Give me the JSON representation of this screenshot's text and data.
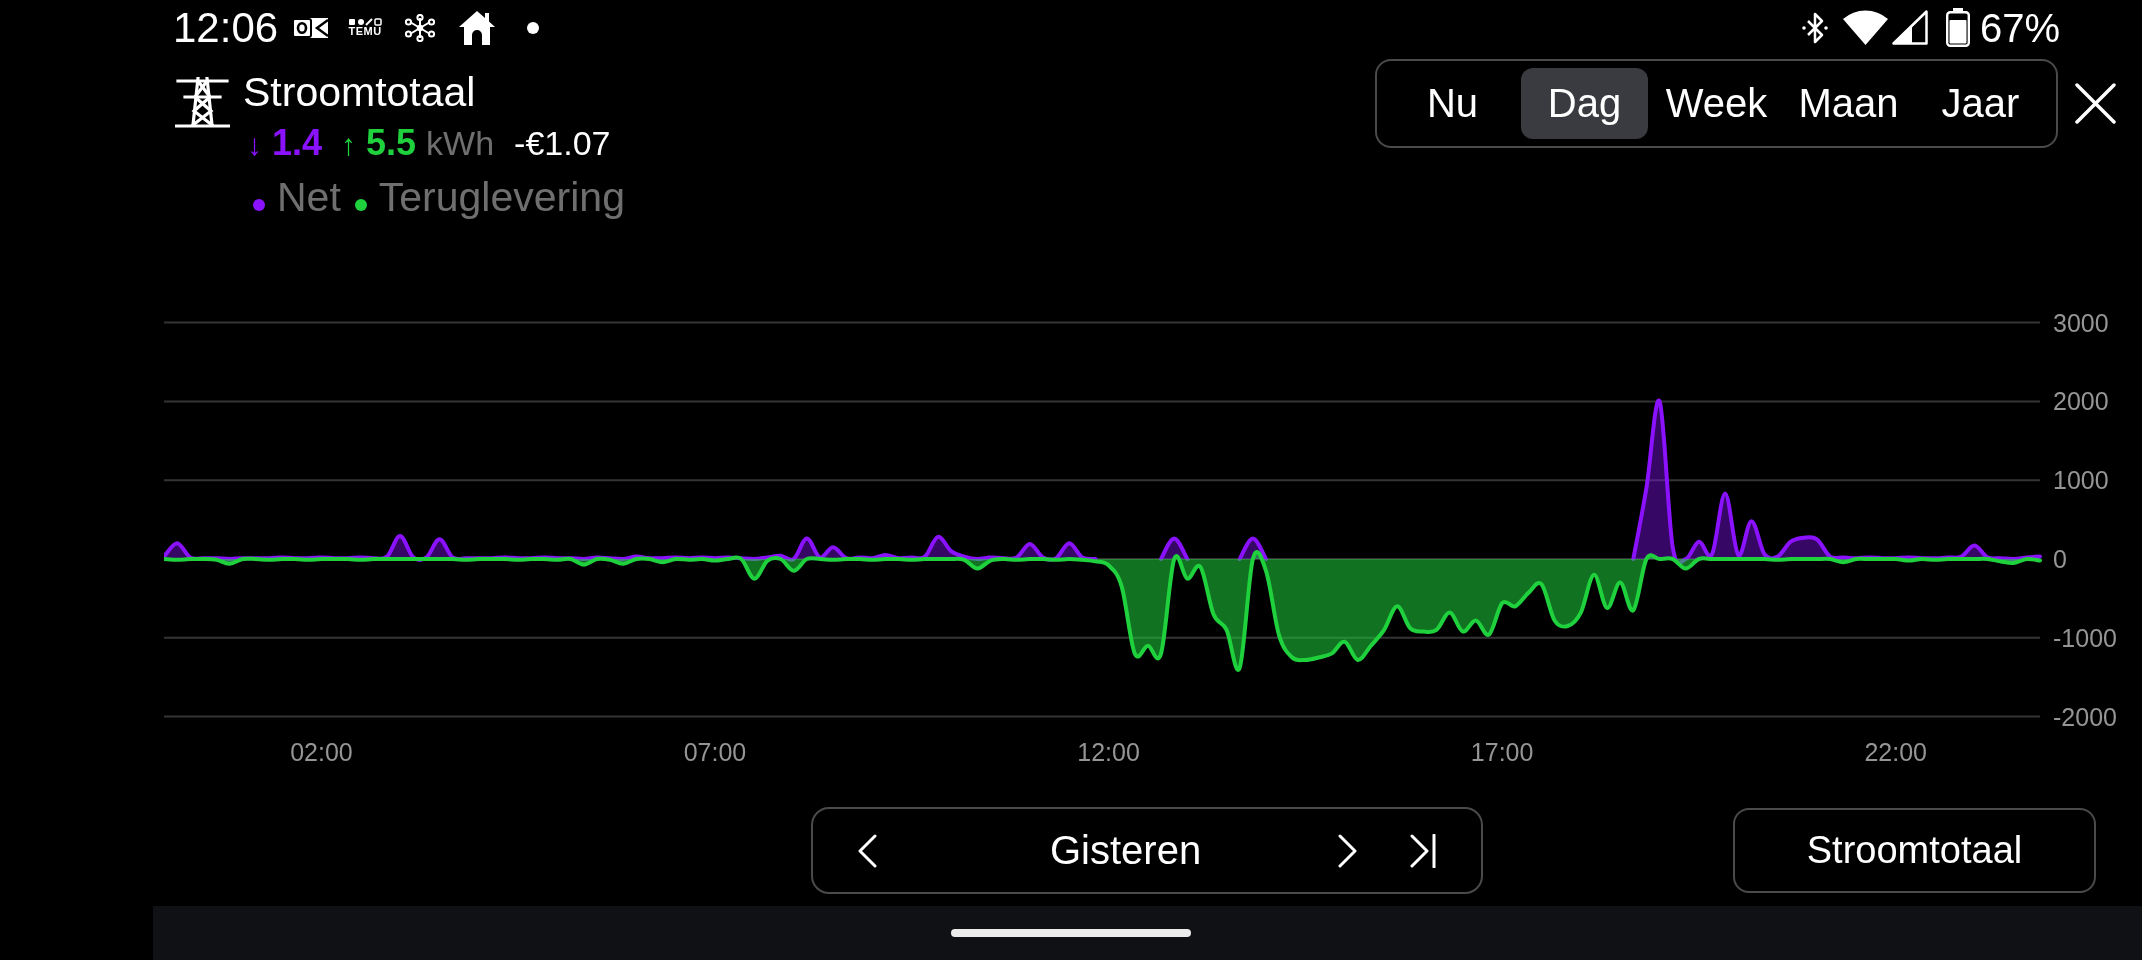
{
  "status_bar": {
    "time": "12:06",
    "app_logo_text": "TEMU",
    "battery": "67%"
  },
  "header": {
    "title": "Stroomtotaal",
    "import": {
      "arrow": "↓",
      "value": "1.4"
    },
    "export": {
      "arrow": "↑",
      "value": "5.5"
    },
    "unit": "kWh",
    "cost": "-€1.07"
  },
  "tabs": [
    {
      "label": "Nu",
      "selected": false
    },
    {
      "label": "Dag",
      "selected": true
    },
    {
      "label": "Week",
      "selected": false
    },
    {
      "label": "Maan",
      "selected": false
    },
    {
      "label": "Jaar",
      "selected": false
    }
  ],
  "chart": {
    "chart_data": {
      "type": "area",
      "grid": true,
      "x": [
        0,
        10,
        20,
        30,
        40,
        50,
        60,
        70,
        80,
        90,
        100,
        110,
        120,
        130,
        140,
        150,
        160,
        170,
        180,
        190,
        200,
        210,
        220,
        230,
        240,
        250,
        260,
        270,
        280,
        290,
        300,
        310,
        320,
        330,
        340,
        350,
        360,
        370,
        380,
        390,
        400,
        410,
        420,
        430,
        440,
        450,
        460,
        470,
        480,
        490,
        500,
        510,
        520,
        530,
        540,
        550,
        560,
        570,
        580,
        590,
        600,
        610,
        620,
        630,
        640,
        650,
        660,
        670,
        680,
        690,
        700,
        710,
        720,
        730,
        740,
        750,
        760,
        770,
        780,
        790,
        800,
        810,
        820,
        830,
        840,
        850,
        860,
        870,
        880,
        890,
        900,
        910,
        920,
        930,
        940,
        950,
        960,
        970,
        980,
        990,
        1000,
        1010,
        1020,
        1030,
        1040,
        1050,
        1060,
        1070,
        1080,
        1090,
        1100,
        1110,
        1120,
        1130,
        1140,
        1150,
        1160,
        1170,
        1180,
        1190,
        1200,
        1210,
        1220,
        1230,
        1240,
        1250,
        1260,
        1270,
        1280,
        1290,
        1300,
        1310,
        1320,
        1330,
        1340,
        1350,
        1360,
        1370,
        1380,
        1390,
        1400,
        1410,
        1420,
        1430
      ],
      "series": [
        {
          "name": "Net",
          "color": "#8a12ff",
          "values": [
            30,
            200,
            20,
            10,
            10,
            0,
            10,
            10,
            10,
            20,
            10,
            10,
            20,
            10,
            10,
            20,
            10,
            30,
            290,
            20,
            20,
            250,
            20,
            10,
            10,
            10,
            20,
            10,
            10,
            20,
            10,
            10,
            0,
            20,
            10,
            0,
            30,
            10,
            10,
            20,
            10,
            20,
            10,
            20,
            10,
            0,
            20,
            40,
            0,
            260,
            20,
            150,
            10,
            20,
            10,
            50,
            10,
            20,
            30,
            280,
            100,
            30,
            0,
            20,
            10,
            20,
            190,
            20,
            10,
            200,
            20,
            0,
            null,
            null,
            null,
            null,
            0,
            260,
            0,
            null,
            null,
            null,
            0,
            260,
            0,
            null,
            null,
            null,
            null,
            null,
            null,
            null,
            null,
            null,
            null,
            null,
            null,
            null,
            null,
            null,
            null,
            null,
            null,
            null,
            null,
            null,
            null,
            null,
            null,
            null,
            null,
            null,
            0,
            900,
            2000,
            150,
            0,
            220,
            60,
            830,
            50,
            480,
            60,
            30,
            220,
            270,
            250,
            30,
            20,
            10,
            20,
            10,
            10,
            20,
            10,
            10,
            20,
            30,
            170,
            20,
            10,
            0,
            20,
            30
          ]
        },
        {
          "name": "Teruglevering",
          "color": "#1fd23d",
          "values": [
            0,
            -10,
            0,
            0,
            -10,
            -60,
            0,
            0,
            -10,
            0,
            0,
            -10,
            0,
            0,
            0,
            -10,
            0,
            0,
            0,
            0,
            0,
            0,
            0,
            -10,
            0,
            0,
            0,
            -10,
            0,
            0,
            -10,
            0,
            -70,
            0,
            -10,
            -60,
            0,
            0,
            -40,
            0,
            -10,
            0,
            -20,
            0,
            0,
            -250,
            -20,
            0,
            -150,
            0,
            0,
            -10,
            0,
            0,
            -10,
            0,
            0,
            -10,
            0,
            0,
            0,
            -10,
            -120,
            -20,
            0,
            -10,
            0,
            0,
            -10,
            0,
            -10,
            -30,
            -80,
            -350,
            -1200,
            -1100,
            -1200,
            0,
            -250,
            -100,
            -700,
            -900,
            -1380,
            0,
            -150,
            -970,
            -1250,
            -1280,
            -1250,
            -1200,
            -1050,
            -1280,
            -1100,
            -900,
            -600,
            -880,
            -920,
            -900,
            -680,
            -920,
            -780,
            -960,
            -560,
            -600,
            -430,
            -320,
            -780,
            -850,
            -680,
            -200,
            -620,
            -300,
            -650,
            0,
            0,
            0,
            -120,
            0,
            0,
            0,
            0,
            0,
            0,
            -10,
            0,
            0,
            0,
            0,
            -40,
            0,
            0,
            0,
            0,
            -20,
            0,
            -10,
            0,
            0,
            0,
            0,
            -30,
            -50,
            0,
            -20
          ]
        }
      ],
      "xlim": [
        0,
        1430
      ],
      "ylim": [
        -2000,
        3000
      ],
      "xticks": [
        {
          "value": 120,
          "label": "02:00"
        },
        {
          "value": 420,
          "label": "07:00"
        },
        {
          "value": 720,
          "label": "12:00"
        },
        {
          "value": 1020,
          "label": "17:00"
        },
        {
          "value": 1320,
          "label": "22:00"
        }
      ],
      "yticks": [
        -2000,
        -1000,
        0,
        1000,
        2000,
        3000
      ]
    }
  },
  "date_nav": {
    "label": "Gisteren"
  },
  "selector_button": {
    "label": "Stroomtotaal"
  }
}
